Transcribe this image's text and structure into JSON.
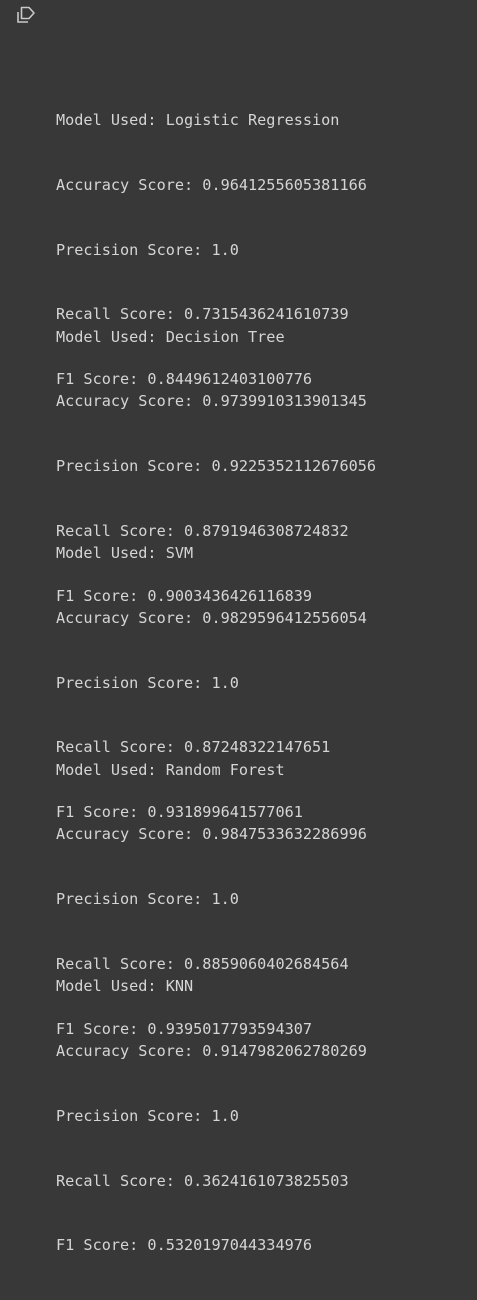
{
  "output_icon": "output-redirect-icon",
  "colors": {
    "background": "#383838",
    "text": "#d5d5d5",
    "icon": "#c9c9c9"
  },
  "results": [
    {
      "model": "Model Used: Logistic Regression",
      "accuracy": "Accuracy Score: 0.9641255605381166",
      "precision": "Precision Score: 1.0",
      "recall": "Recall Score: 0.7315436241610739",
      "f1": "F1 Score: 0.8449612403100776"
    },
    {
      "model": "Model Used: Decision Tree",
      "accuracy": "Accuracy Score: 0.9739910313901345",
      "precision": "Precision Score: 0.9225352112676056",
      "recall": "Recall Score: 0.8791946308724832",
      "f1": "F1 Score: 0.9003436426116839"
    },
    {
      "model": "Model Used: SVM",
      "accuracy": "Accuracy Score: 0.9829596412556054",
      "precision": "Precision Score: 1.0",
      "recall": "Recall Score: 0.87248322147651",
      "f1": "F1 Score: 0.931899641577061"
    },
    {
      "model": "Model Used: Random Forest",
      "accuracy": "Accuracy Score: 0.9847533632286996",
      "precision": "Precision Score: 1.0",
      "recall": "Recall Score: 0.8859060402684564",
      "f1": "F1 Score: 0.9395017793594307"
    },
    {
      "model": "Model Used: KNN",
      "accuracy": "Accuracy Score: 0.9147982062780269",
      "precision": "Precision Score: 1.0",
      "recall": "Recall Score: 0.3624161073825503",
      "f1": "F1 Score: 0.5320197044334976"
    }
  ]
}
